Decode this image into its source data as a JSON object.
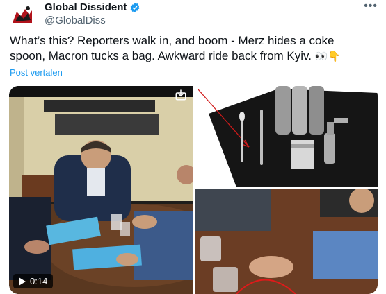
{
  "author": {
    "display_name": "Global Dissident",
    "handle": "@GlobalDiss",
    "verified_badge_color": "#1d9bf0"
  },
  "tweet": {
    "text": "What’s this? Reporters walk in, and boom - Merz hides a coke spoon, Macron tucks a bag. Awkward ride back from Kyiv.",
    "emoji": "👀👇"
  },
  "translate_label": "Post vertalen",
  "media": {
    "video_duration": "0:14"
  },
  "icons": {
    "more": "more-icon",
    "verified": "verified-badge-icon",
    "play": "play-icon",
    "download": "download-icon"
  },
  "colors": {
    "link": "#1d9bf0",
    "text": "#0f1419",
    "muted": "#536471"
  }
}
